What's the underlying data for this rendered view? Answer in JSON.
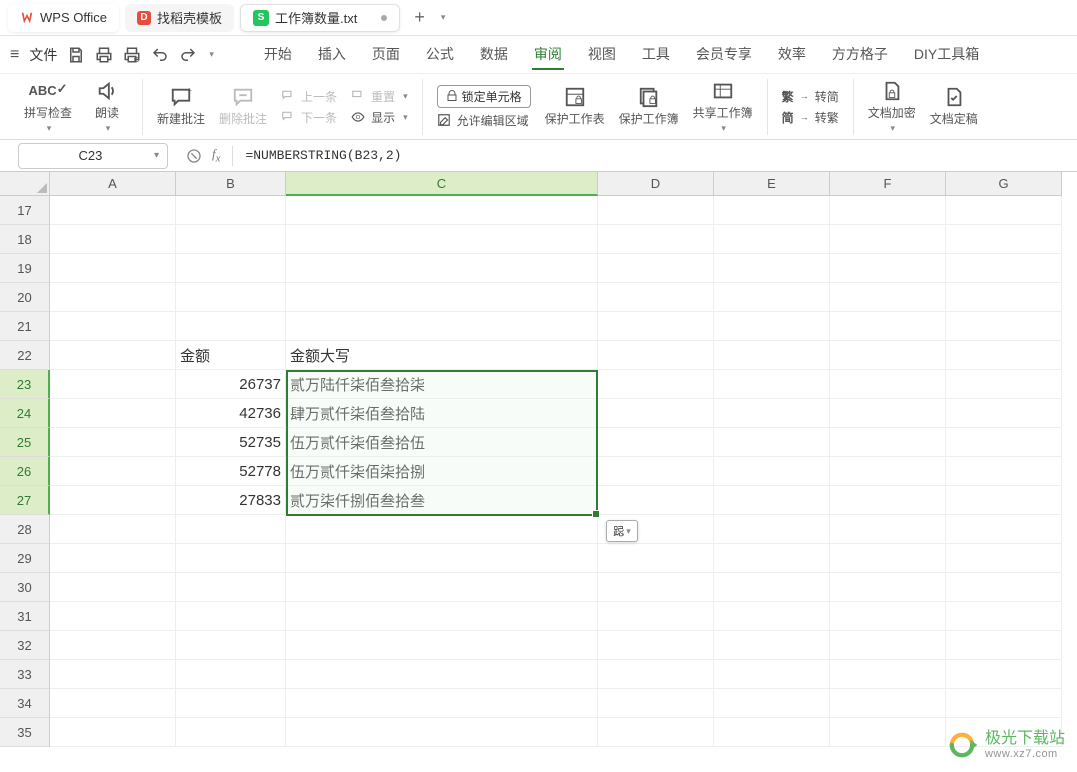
{
  "titlebar": {
    "app_name": "WPS Office",
    "template_tab": "找稻壳模板",
    "doc_tab": "工作簿数量.txt"
  },
  "menubar": {
    "file": "文件",
    "items": [
      "开始",
      "插入",
      "页面",
      "公式",
      "数据",
      "审阅",
      "视图",
      "工具",
      "会员专享",
      "效率",
      "方方格子",
      "DIY工具箱"
    ]
  },
  "ribbon": {
    "spell_check": "拼写检查",
    "read_aloud": "朗读",
    "new_comment": "新建批注",
    "delete_comment": "删除批注",
    "prev": "上一条",
    "next": "下一条",
    "reset": "重置",
    "show": "显示",
    "lock_cell": "锁定单元格",
    "allow_edit": "允许编辑区域",
    "protect_sheet": "保护工作表",
    "protect_book": "保护工作簿",
    "share_book": "共享工作簿",
    "to_simple": "转简",
    "to_trad": "转繁",
    "simple_char": "简",
    "trad_char": "繁",
    "doc_encrypt": "文档加密",
    "doc_finalize": "文档定稿"
  },
  "formula_bar": {
    "name_box": "C23",
    "formula": "=NUMBERSTRING(B23,2)"
  },
  "columns": [
    "A",
    "B",
    "C",
    "D",
    "E",
    "F",
    "G"
  ],
  "rows": [
    17,
    18,
    19,
    20,
    21,
    22,
    23,
    24,
    25,
    26,
    27,
    28,
    29,
    30,
    31,
    32,
    33,
    34,
    35
  ],
  "selected_rows": [
    23,
    24,
    25,
    26,
    27
  ],
  "header_row": {
    "b": "金额",
    "c": "金额大写"
  },
  "data_rows": [
    {
      "b": "26737",
      "c": "贰万陆仟柒佰叁拾柒"
    },
    {
      "b": "42736",
      "c": "肆万贰仟柒佰叁拾陆"
    },
    {
      "b": "52735",
      "c": "伍万贰仟柒佰叁拾伍"
    },
    {
      "b": "52778",
      "c": "伍万贰仟柒佰柒拾捌"
    },
    {
      "b": "27833",
      "c": "贰万柒仟捌佰叁拾叁"
    }
  ],
  "paste_hint": "跽",
  "watermark": {
    "line1": "极光下载站",
    "line2": "www.xz7.com"
  }
}
